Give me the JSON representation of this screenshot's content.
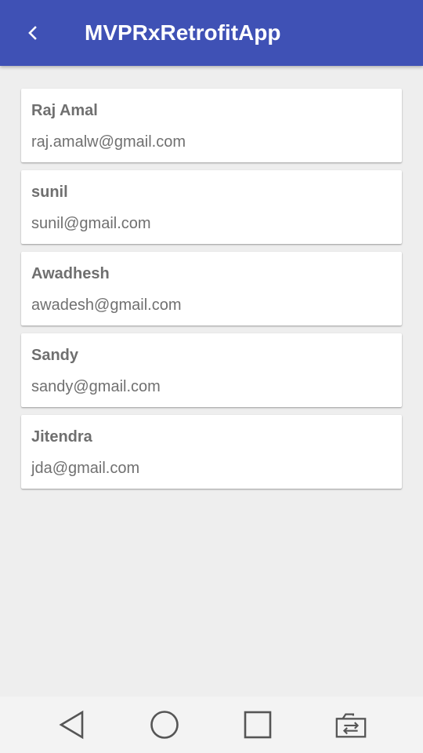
{
  "app_bar": {
    "title": "MVPRxRetrofitApp",
    "back_icon": "chevron-left-icon",
    "color": "#3f51b5"
  },
  "users": [
    {
      "name": "Raj Amal",
      "email": "raj.amalw@gmail.com"
    },
    {
      "name": "sunil",
      "email": "sunil@gmail.com"
    },
    {
      "name": "Awadhesh",
      "email": "awadesh@gmail.com"
    },
    {
      "name": "Sandy",
      "email": "sandy@gmail.com"
    },
    {
      "name": "Jitendra",
      "email": "jda@gmail.com"
    }
  ],
  "nav_bar": {
    "icons": [
      "back-triangle-icon",
      "home-circle-icon",
      "recents-square-icon",
      "switch-app-icon"
    ]
  }
}
